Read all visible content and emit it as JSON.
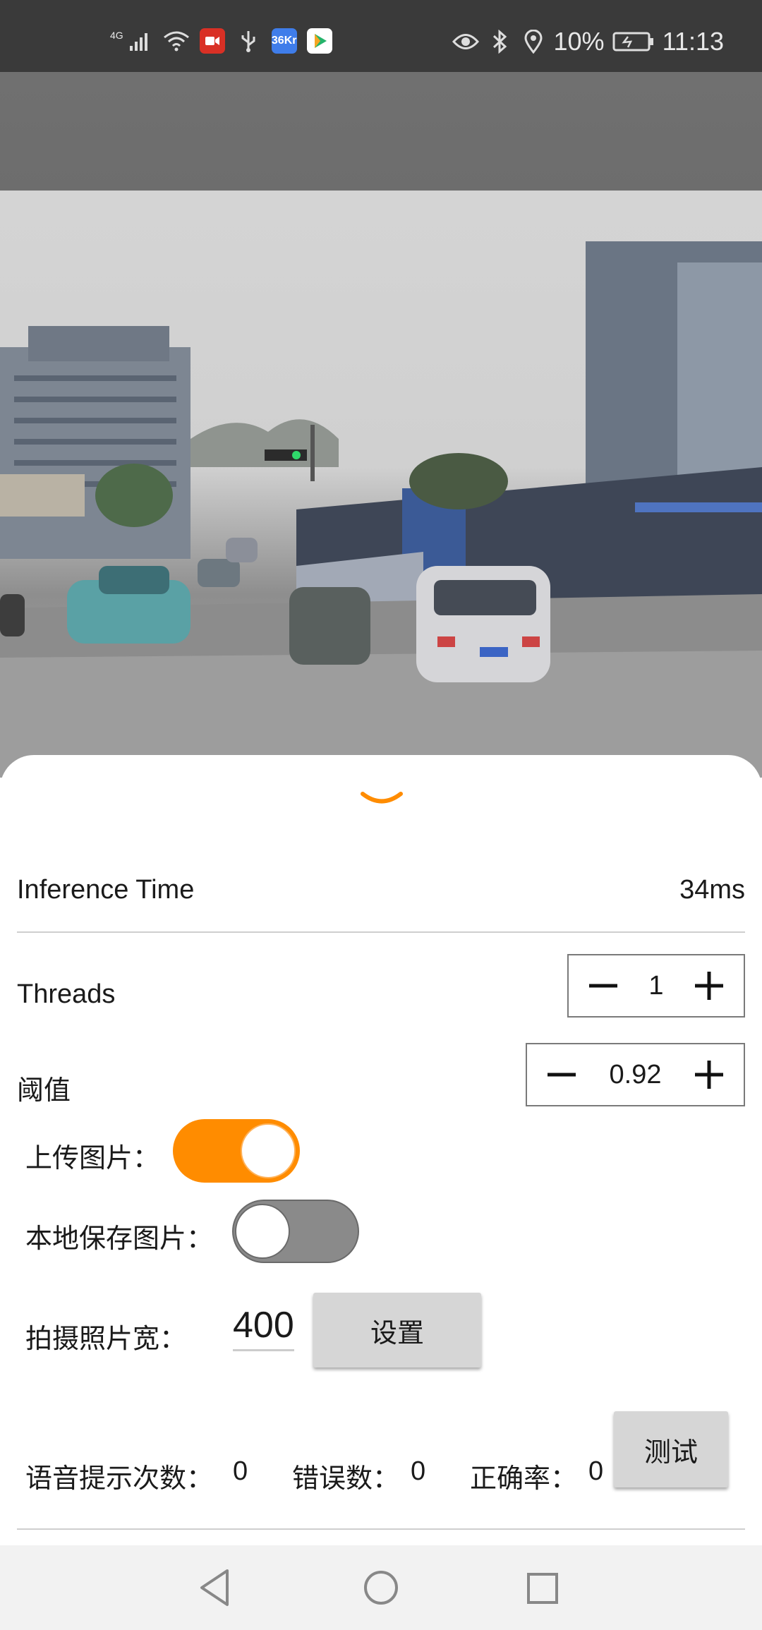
{
  "status_bar": {
    "network": "4G",
    "battery": "10%",
    "time": "11:13",
    "icons": [
      "signal-icon",
      "wifi-icon",
      "screen-record-icon",
      "usb-icon",
      "app-36kr-icon",
      "app-video-icon",
      "eye-icon",
      "bluetooth-icon",
      "location-icon",
      "battery-icon"
    ],
    "app_36kr_label": "36Kr"
  },
  "sheet": {
    "inference_label": "Inference Time",
    "inference_value": "34ms",
    "threads_label": "Threads",
    "threads_value": "1",
    "threshold_label": "阈值",
    "threshold_value": "0.92",
    "upload_label": "上传图片：",
    "upload_on": true,
    "save_label": "本地保存图片：",
    "save_on": false,
    "width_label": "拍摄照片宽：",
    "width_value": "400",
    "set_button": "设置",
    "voice_count_label": "语音提示次数：",
    "voice_count_value": "0",
    "error_count_label": "错误数：",
    "error_count_value": "0",
    "accuracy_label": "正确率：",
    "accuracy_value": "0",
    "test_button": "测试"
  },
  "colors": {
    "accent": "#ff8c00",
    "status_bar": "#3a3a3a",
    "toggle_off": "#8a8a8a"
  }
}
